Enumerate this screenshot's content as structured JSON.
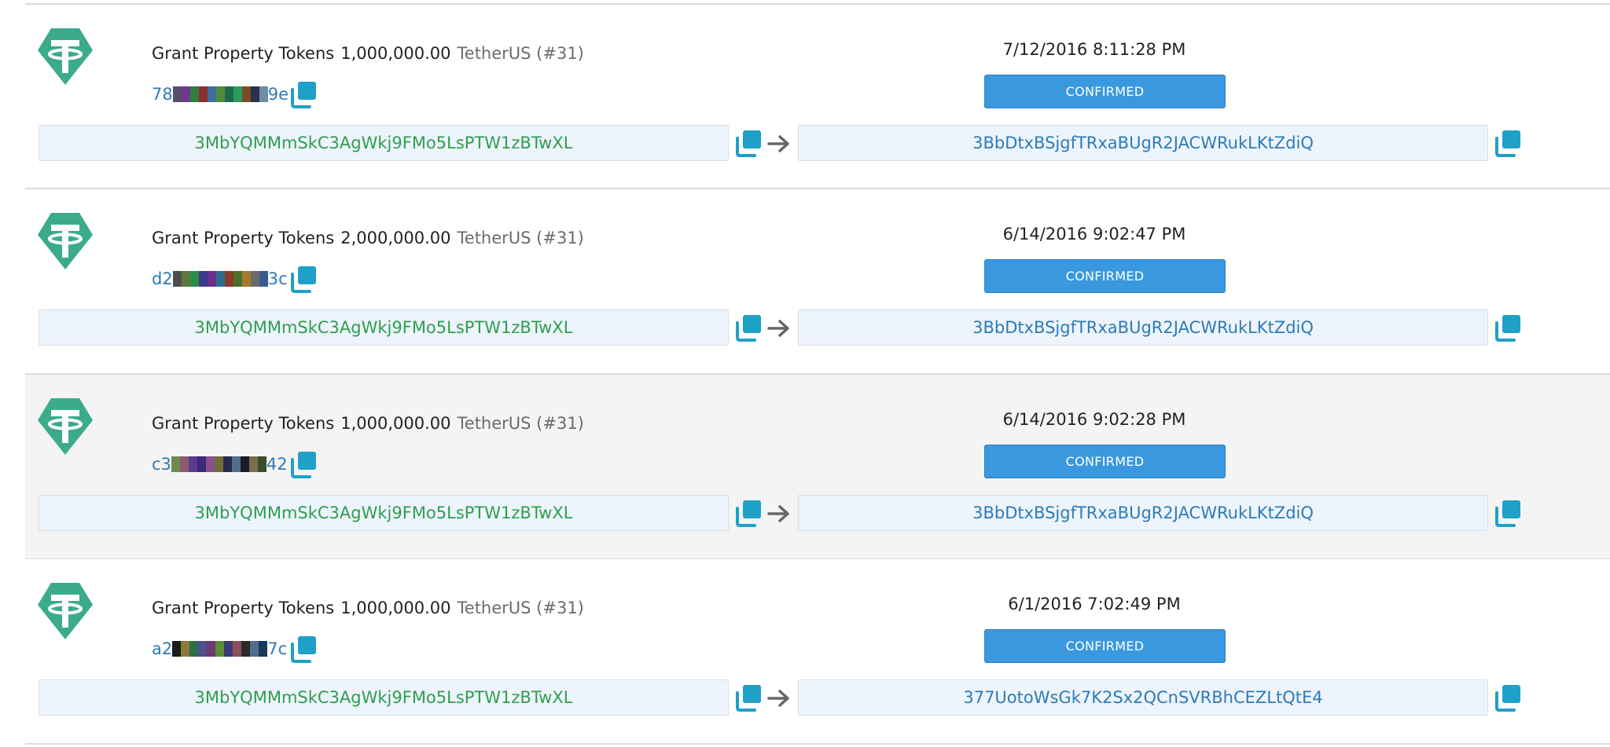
{
  "colors": {
    "from_address": "#2e9e4f",
    "to_address": "#2b7bb9",
    "status_bg": "#3a99de",
    "logo": "#3bab8c",
    "copy_icon": "#1fa0c7"
  },
  "icons": {
    "logo": "tether-logo-icon",
    "copy": "copy-icon",
    "arrow": "arrow-right-icon"
  },
  "transactions": [
    {
      "type": "Grant Property Tokens",
      "amount": "1,000,000.00",
      "property": "TetherUS (#31)",
      "hash_prefix": "78",
      "hash_suffix": "9e",
      "hash_swatches": [
        "#5a4d6e",
        "#6a3b8c",
        "#2e7f3a",
        "#8b2e2e",
        "#3d6ea0",
        "#4e8c3a",
        "#1f6b4f",
        "#2a9a5f",
        "#7a4b2a",
        "#2d2d4e",
        "#6b8ea5"
      ],
      "datetime": "7/12/2016 8:11:28 PM",
      "status": "CONFIRMED",
      "from": "3MbYQMMmSkC3AgWkj9FMo5LsPTW1zBTwXL",
      "to": "3BbDtxBSjgfTRxaBUgR2JACWRukLKtZdiQ"
    },
    {
      "type": "Grant Property Tokens",
      "amount": "2,000,000.00",
      "property": "TetherUS (#31)",
      "hash_prefix": "d2",
      "hash_suffix": "3c",
      "hash_swatches": [
        "#4e4e4e",
        "#5a7a3a",
        "#2e8c4a",
        "#3a3a8c",
        "#6b2e8c",
        "#2a6e8c",
        "#8c3a2a",
        "#4e6e2a",
        "#a57a2e",
        "#6b6b6b",
        "#3a5a8c"
      ],
      "datetime": "6/14/2016 9:02:47 PM",
      "status": "CONFIRMED",
      "from": "3MbYQMMmSkC3AgWkj9FMo5LsPTW1zBTwXL",
      "to": "3BbDtxBSjgfTRxaBUgR2JACWRukLKtZdiQ"
    },
    {
      "type": "Grant Property Tokens",
      "amount": "1,000,000.00",
      "property": "TetherUS (#31)",
      "hash_prefix": "c3",
      "hash_suffix": "42",
      "hash_swatches": [
        "#6e8c4e",
        "#8c5a6e",
        "#5a3a8c",
        "#3a2a7a",
        "#8c4e8c",
        "#6e6e3a",
        "#2a2a4e",
        "#4e6e8c",
        "#1a1a2e",
        "#7a6e4e",
        "#3a4e2a"
      ],
      "datetime": "6/14/2016 9:02:28 PM",
      "status": "CONFIRMED",
      "from": "3MbYQMMmSkC3AgWkj9FMo5LsPTW1zBTwXL",
      "to": "3BbDtxBSjgfTRxaBUgR2JACWRukLKtZdiQ"
    },
    {
      "type": "Grant Property Tokens",
      "amount": "1,000,000.00",
      "property": "TetherUS (#31)",
      "hash_prefix": "a2",
      "hash_suffix": "7c",
      "hash_swatches": [
        "#1a1a1a",
        "#8c7a3a",
        "#2e6e4e",
        "#4e4e8c",
        "#6e3a6e",
        "#5a8c3a",
        "#3a3a6e",
        "#8c4e5a",
        "#2a2a2a",
        "#4e6e8c",
        "#1a3a5a"
      ],
      "datetime": "6/1/2016 7:02:49 PM",
      "status": "CONFIRMED",
      "from": "3MbYQMMmSkC3AgWkj9FMo5LsPTW1zBTwXL",
      "to": "377UotoWsGk7K2Sx2QCnSVRBhCEZLtQtE4"
    }
  ]
}
